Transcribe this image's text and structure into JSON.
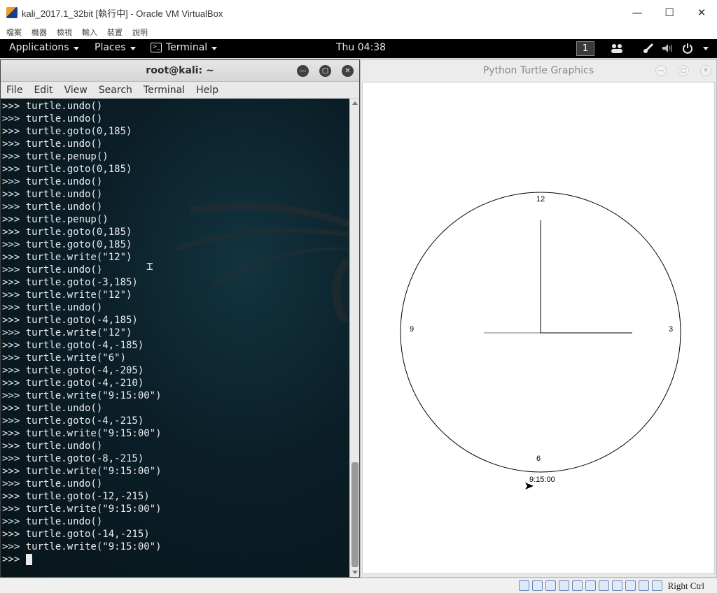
{
  "vbox": {
    "title": "kali_2017.1_32bit [執行中] - Oracle VM VirtualBox",
    "menu": [
      "檔案",
      "機器",
      "檢視",
      "輸入",
      "裝置",
      "說明"
    ],
    "status_icon_names": [
      "hdd-icon",
      "optical-icon",
      "usb-icon",
      "network-icon",
      "shared-folder-icon",
      "display-icon",
      "video-capture-icon",
      "vm-window-icon",
      "cpu-icon",
      "mouse-integration-icon",
      "keyboard-capture-icon"
    ],
    "host_key": "Right Ctrl"
  },
  "topbar": {
    "applications": "Applications",
    "places": "Places",
    "terminal": "Terminal",
    "clock": "Thu 04:38",
    "workspace": "1"
  },
  "terminal": {
    "title": "root@kali: ~",
    "menu": [
      "File",
      "Edit",
      "View",
      "Search",
      "Terminal",
      "Help"
    ],
    "lines": [
      ">>> turtle.undo()",
      ">>> turtle.undo()",
      ">>> turtle.goto(0,185)",
      ">>> turtle.undo()",
      ">>> turtle.penup()",
      ">>> turtle.goto(0,185)",
      ">>> turtle.undo()",
      ">>> turtle.undo()",
      ">>> turtle.undo()",
      ">>> turtle.penup()",
      ">>> turtle.goto(0,185)",
      ">>> turtle.goto(0,185)",
      ">>> turtle.write(\"12\")",
      ">>> turtle.undo()",
      ">>> turtle.goto(-3,185)",
      ">>> turtle.write(\"12\")",
      ">>> turtle.undo()",
      ">>> turtle.goto(-4,185)",
      ">>> turtle.write(\"12\")",
      ">>> turtle.goto(-4,-185)",
      ">>> turtle.write(\"6\")",
      ">>> turtle.goto(-4,-205)",
      ">>> turtle.goto(-4,-210)",
      ">>> turtle.write(\"9:15:00\")",
      ">>> turtle.undo()",
      ">>> turtle.goto(-4,-215)",
      ">>> turtle.write(\"9:15:00\")",
      ">>> turtle.undo()",
      ">>> turtle.goto(-8,-215)",
      ">>> turtle.write(\"9:15:00\")",
      ">>> turtle.undo()",
      ">>> turtle.goto(-12,-215)",
      ">>> turtle.write(\"9:15:00\")",
      ">>> turtle.undo()",
      ">>> turtle.goto(-14,-215)",
      ">>> turtle.write(\"9:15:00\")"
    ],
    "prompt": ">>>"
  },
  "turtle": {
    "title": "Python Turtle Graphics",
    "numbers": {
      "n12": "12",
      "n3": "3",
      "n6": "6",
      "n9": "9"
    },
    "time_text": "9:15:00",
    "colors": {
      "ink": "#000000",
      "hour_hand": "#777777"
    }
  }
}
